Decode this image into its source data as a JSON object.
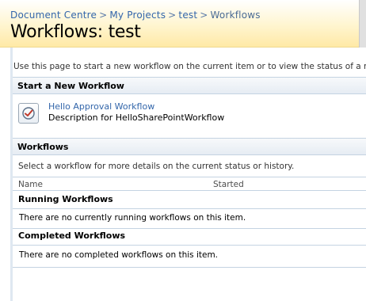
{
  "breadcrumb": {
    "items": [
      "Document Centre",
      "My Projects",
      "test",
      "Workflows"
    ],
    "separator": ">"
  },
  "page": {
    "title": "Workflows: test",
    "intro": "Use this page to start a new workflow on the current item or to view the status of a running o"
  },
  "start_section": {
    "header": "Start a New Workflow",
    "workflow_name": "Hello Approval Workflow",
    "workflow_description": "Description for HelloSharePointWorkflow",
    "icon": "workflow-check-icon"
  },
  "workflows_section": {
    "header": "Workflows",
    "instruction": "Select a workflow for more details on the current status or history.",
    "columns": [
      "Name",
      "Started"
    ],
    "running_title": "Running Workflows",
    "running_empty": "There are no currently running workflows on this item.",
    "completed_title": "Completed Workflows",
    "completed_empty": "There are no completed workflows on this item."
  },
  "colors": {
    "link": "#3366aa",
    "header_gradient_end": "#ffe9a6",
    "section_border": "#c4d3e2"
  }
}
